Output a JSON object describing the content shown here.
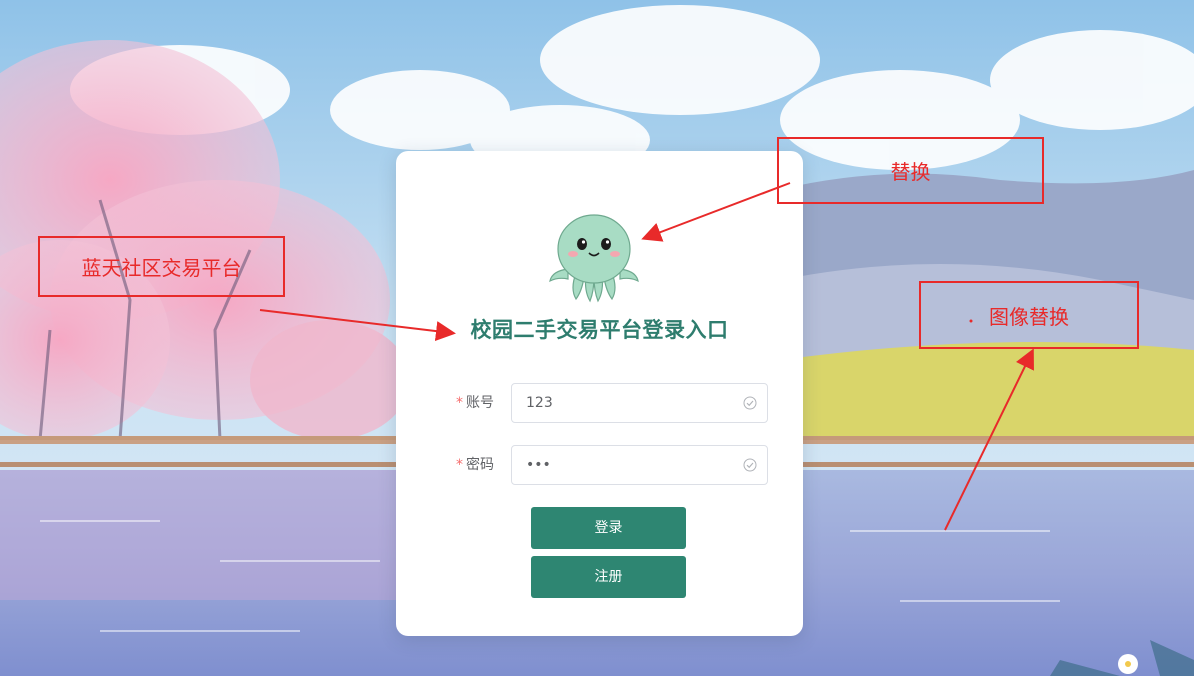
{
  "login": {
    "title": "校园二手交易平台登录入口",
    "account_label": "账号",
    "account_value": "123",
    "password_label": "密码",
    "password_value": "•••",
    "required_mark": "*",
    "login_button": "登录",
    "register_button": "注册"
  },
  "annotations": {
    "left": "蓝天社区交易平台",
    "top_right": "替换",
    "right": "图像替换"
  },
  "colors": {
    "accent": "#2e8672",
    "title": "#2e7d6e",
    "annotation": "#e82a2a"
  },
  "icons": {
    "logo": "octopus-logo",
    "input_valid": "circle-check-icon"
  }
}
